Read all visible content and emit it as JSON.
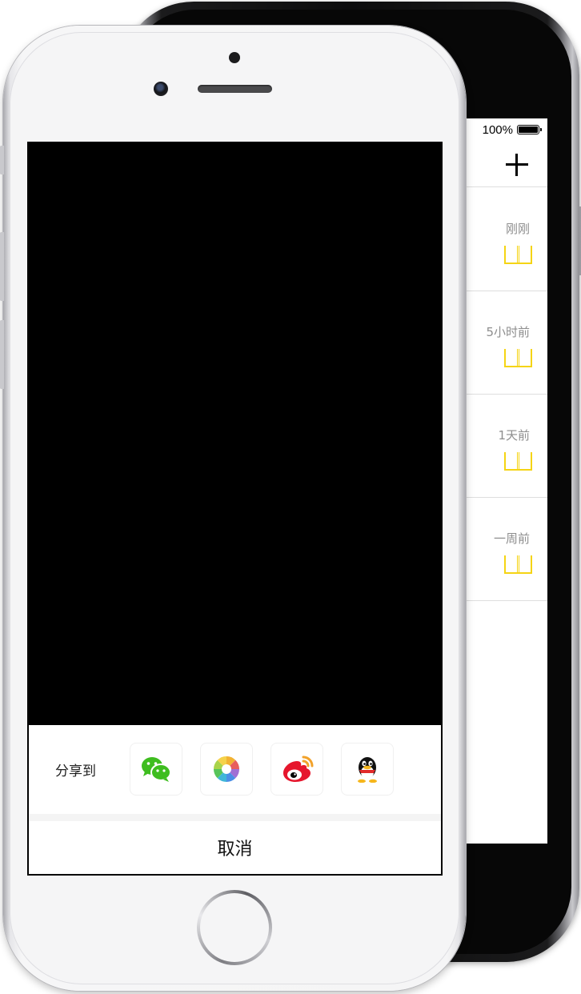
{
  "back_screen": {
    "status": {
      "battery_percent": "100%"
    },
    "nav": {
      "add_icon": "plus-icon"
    },
    "rows": [
      {
        "time": "刚刚",
        "icon": "book-icon"
      },
      {
        "time": "5小时前",
        "icon": "book-icon"
      },
      {
        "time": "1天前",
        "icon": "book-icon"
      },
      {
        "time": "一周前",
        "icon": "book-icon"
      }
    ],
    "accent_color": "#f5d414"
  },
  "share_sheet": {
    "label": "分享到",
    "targets": [
      {
        "icon": "wechat-icon",
        "color": "#3ebd1f"
      },
      {
        "icon": "moments-icon",
        "color": "#f2b233"
      },
      {
        "icon": "weibo-icon",
        "color": "#e6162d"
      },
      {
        "icon": "qq-icon",
        "color": "#000000"
      }
    ],
    "cancel_label": "取消"
  }
}
